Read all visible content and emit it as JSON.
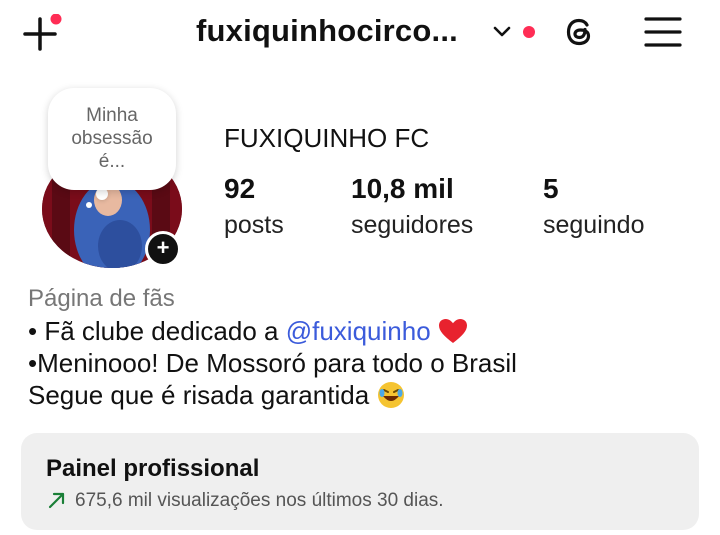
{
  "header": {
    "username": "fuxiquinhocirco...",
    "icons": {
      "new_post": "plus-icon",
      "switch_account": "chevron-down-icon",
      "threads": "threads-icon",
      "menu": "hamburger-menu-icon"
    },
    "notification_color": "#ff2d55"
  },
  "profile": {
    "note": [
      "Minha",
      "obsessão",
      "é..."
    ],
    "display_name": "FUXIQUINHO FC",
    "stats": [
      {
        "value": "92",
        "label": "posts"
      },
      {
        "value": "10,8 mil",
        "label": "seguidores"
      },
      {
        "value": "5",
        "label": "seguindo"
      }
    ]
  },
  "bio": {
    "category": "Página de fãs",
    "line1_prefix": "• Fã clube dedicado a ",
    "line1_mention": "@fuxiquinho",
    "line1_emoji": "heart",
    "line2": "•Meninooo! De Mossoró para todo o Brasil",
    "line3": "Segue que é risada garantida",
    "line3_emoji": "rolling-laughing-face",
    "mention_color": "#3b5bdb"
  },
  "dashboard": {
    "title": "Painel profissional",
    "subtitle": "675,6 mil visualizações nos últimos 30 dias.",
    "trend_icon": "trending-up-icon",
    "trend_color": "#1a7f37"
  }
}
